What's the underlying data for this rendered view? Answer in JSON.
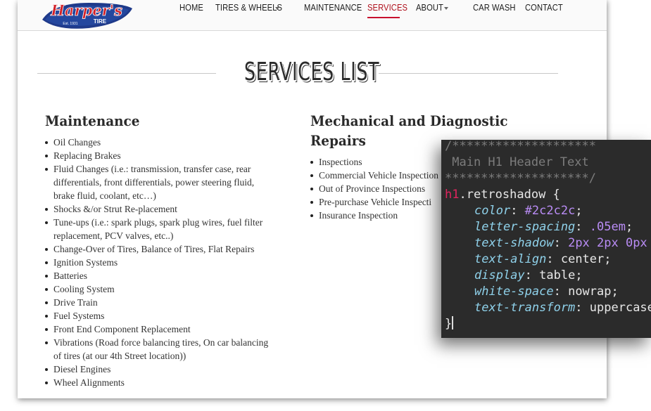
{
  "nav": {
    "logo_text": "Harper's",
    "logo_sub": "TIRE",
    "logo_est": "Est. 1931",
    "items": [
      {
        "label": "HOME"
      },
      {
        "label": "TIRES & WHEELS"
      },
      {
        "label": "MAINTENANCE"
      },
      {
        "label": "SERVICES"
      },
      {
        "label": "ABOUT"
      },
      {
        "label": "CAR WASH"
      },
      {
        "label": "CONTACT"
      }
    ],
    "active": "SERVICES"
  },
  "page_title": "SERVICES LIST",
  "maintenance": {
    "heading": "Maintenance",
    "items": [
      "Oil Changes",
      "Replacing Brakes",
      "Fluid Changes (i.e.: transmission, transfer case, rear",
      "differentials, front differentials, power steering fluid,",
      "brake fluid, coolant, etc…)",
      "Shocks &/or Strut Re-placement",
      "Tune-ups (i.e.: spark plugs, spark plug wires, fuel filter",
      "replacement, PCV valves, etc..)",
      "Change-Over of Tires, Balance of Tires, Flat Repairs",
      "Ignition Systems",
      "Batteries",
      "Cooling System",
      "Drive Train",
      "Fuel Systems",
      "Front End Component Replacement",
      "Vibrations (Road force balancing tires, On car balancing",
      "of tires (at our 4th Street location))",
      "Diesel Engines",
      "Wheel Alignments"
    ]
  },
  "mechanical": {
    "heading_line1": "Mechanical and Diagnostic",
    "heading_line2": "Repairs",
    "items": [
      "Inspections",
      "Commercial Vehicle Inspection",
      "Out of Province Inspections",
      "Pre-purchase Vehicle Inspecti",
      "Insurance Inspection"
    ]
  },
  "code": {
    "comment1": "/********************",
    "comment2": " Main H1 Header Text",
    "comment3": "********************/",
    "selector_tag": "h1",
    "selector_class": ".retroshadow",
    "open_brace": " {",
    "props": [
      {
        "name": "color",
        "value": "#2c2c2c"
      },
      {
        "name": "letter-spacing",
        "value": ".05em"
      },
      {
        "name": "text-shadow",
        "value": "2px 2px 0px"
      },
      {
        "name": "text-align",
        "value": "center"
      },
      {
        "name": "display",
        "value": "table"
      },
      {
        "name": "white-space",
        "value": "nowrap"
      },
      {
        "name": "text-transform",
        "value": "uppercase"
      }
    ],
    "close_brace": "}"
  }
}
